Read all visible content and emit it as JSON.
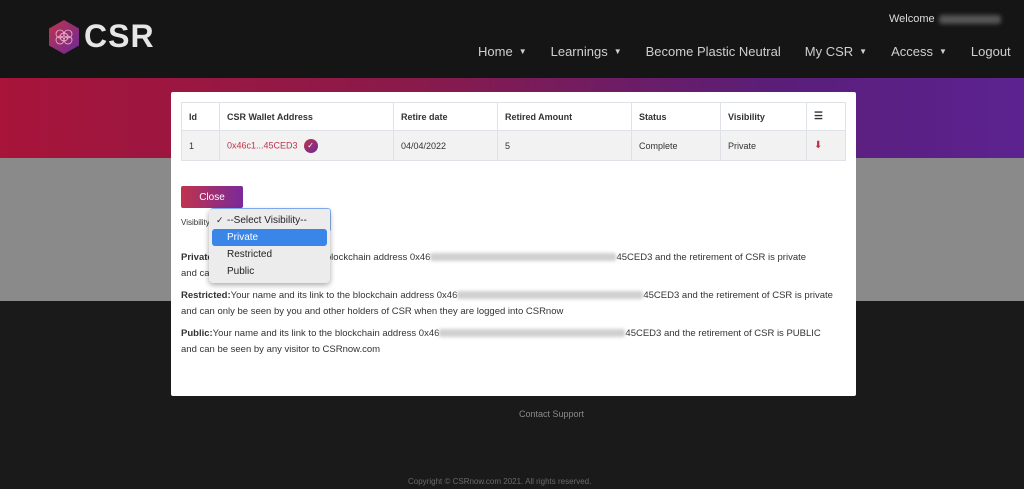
{
  "header": {
    "logo_text": "CSR",
    "welcome_label": "Welcome",
    "nav": [
      {
        "label": "Home",
        "has_caret": true
      },
      {
        "label": "Learnings",
        "has_caret": true
      },
      {
        "label": "Become Plastic Neutral",
        "has_caret": false
      },
      {
        "label": "My CSR",
        "has_caret": true
      },
      {
        "label": "Access",
        "has_caret": true
      },
      {
        "label": "Logout",
        "has_caret": false
      }
    ]
  },
  "table": {
    "headers": [
      "Id",
      "CSR Wallet Address",
      "Retire date",
      "Retired Amount",
      "Status",
      "Visibility"
    ],
    "rows": [
      {
        "id": "1",
        "address": "0x46c1...45CED3",
        "retire_date": "04/04/2022",
        "amount": "5",
        "status": "Complete",
        "visibility": "Private"
      }
    ]
  },
  "modal": {
    "close_label": "Close",
    "visibility_label": "Visibility",
    "select_options": [
      "--Select Visibility--",
      "Private",
      "Restricted",
      "Public"
    ],
    "selected_option": "--Select Visibility--",
    "highlighted_option": "Private"
  },
  "descriptions": {
    "private_title": "Private",
    "private_tail_1": "he blockchain address 0x46",
    "private_tail_2": "45CED3 and the retirement of CSR is private",
    "private_line2": "and ca",
    "restricted_title": "Restricted:",
    "restricted_1": "Your name and its link to the blockchain address 0x46",
    "restricted_2": "45CED3 and the retirement of CSR is private",
    "restricted_line2": "and can only be seen by you and other holders of CSR when they are logged into CSRnow",
    "public_title": "Public:",
    "public_1": "Your name and its link to the blockchain address 0x46",
    "public_2": "45CED3 and the retirement of CSR is PUBLIC",
    "public_line2": "and can be seen by any visitor to CSRnow.com"
  },
  "footer": {
    "contact": "Contact Support",
    "copyright": "Copyright © CSRnow.com 2021. All rights reserved."
  },
  "colors": {
    "accent": "#c0334c",
    "accent_purple": "#6a2a9a",
    "highlight": "#3a85e8"
  },
  "icons": {
    "verified": "verified-badge-icon",
    "download": "download-icon",
    "list": "list-icon",
    "check": "checkmark-icon"
  }
}
